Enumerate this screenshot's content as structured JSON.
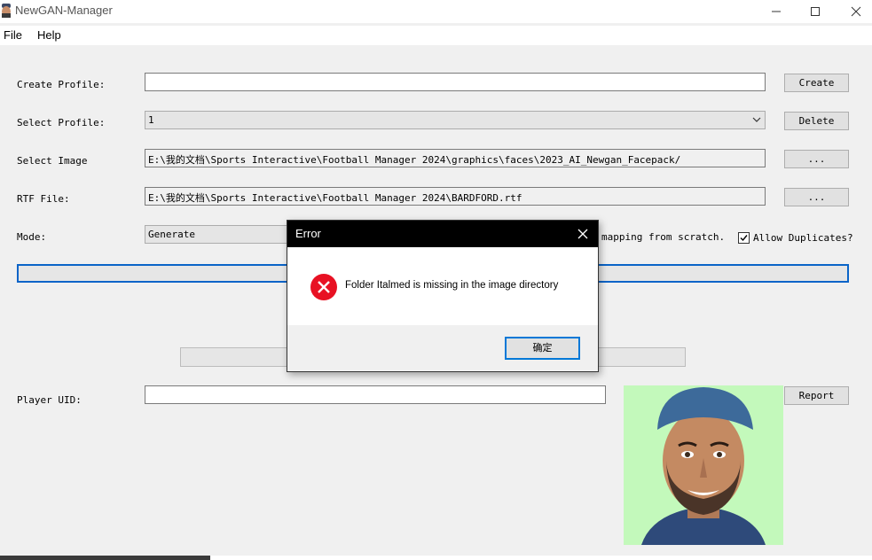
{
  "window": {
    "title": "NewGAN-Manager"
  },
  "menu": {
    "items": [
      "File",
      "Help"
    ]
  },
  "form": {
    "create_profile": {
      "label": "Create Profile:",
      "value": "",
      "button": "Create"
    },
    "select_profile": {
      "label": "Select Profile:",
      "value": "1",
      "button": "Delete"
    },
    "select_image": {
      "label": "Select Image",
      "value": "E:\\我的文档\\Sports Interactive\\Football Manager 2024\\graphics\\faces\\2023_AI_Newgan_Facepack/",
      "button": "..."
    },
    "rtf_file": {
      "label": "RTF File:",
      "value": "E:\\我的文档\\Sports Interactive\\Football Manager 2024\\BARDFORD.rtf",
      "button": "..."
    },
    "mode": {
      "label": "Mode:",
      "value": "Generate",
      "description_fragment": "mapping from scratch.",
      "allow_duplicates_label": "Allow Duplicates?",
      "allow_duplicates_checked": true
    },
    "player_uid": {
      "label": "Player UID:",
      "value": "",
      "button": "Report"
    }
  },
  "dialog": {
    "title": "Error",
    "message": "Folder Italmed is missing in the image directory",
    "ok_label": "确定"
  },
  "colors": {
    "accent": "#0a64c8",
    "error": "#e81123",
    "photo_bg": "#c3f9bb"
  }
}
